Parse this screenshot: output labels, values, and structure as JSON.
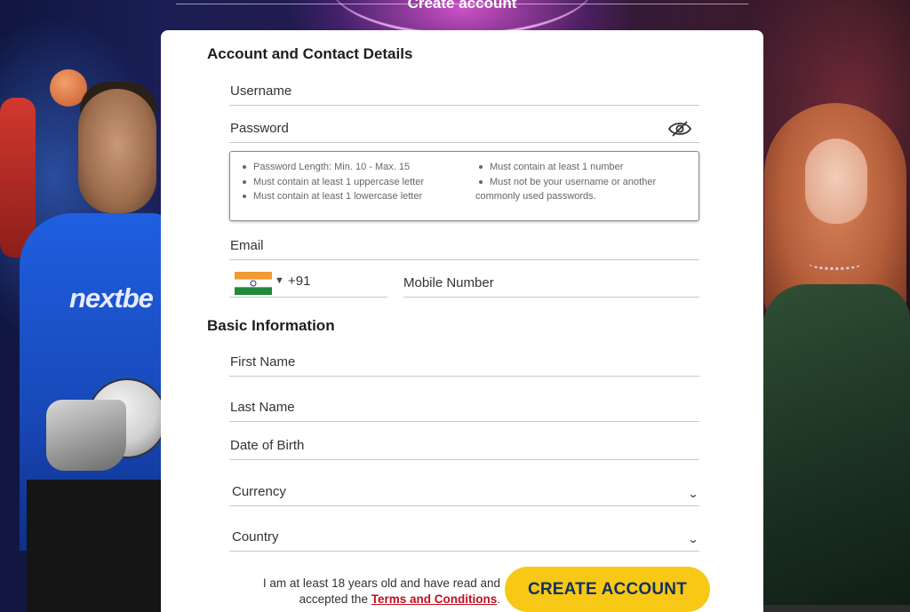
{
  "page": {
    "heading": "Create account"
  },
  "branding": {
    "jersey_logo_a": "nextbe",
    "jersey_logo_b": ""
  },
  "form": {
    "account_section_title": "Account and Contact Details",
    "username_label": "Username",
    "password_label": "Password",
    "password_rules_col_a": [
      "Password Length: Min. 10 - Max. 15",
      "Must contain at least 1 uppercase letter",
      "Must contain at least 1 lowercase letter"
    ],
    "password_rules_col_b": [
      "Must contain at least 1 number",
      "Must not be your username or another",
      "commonly used passwords."
    ],
    "email_label": "Email",
    "phone_country_flag": "india-flag-icon",
    "phone_dial_code": "+91",
    "mobile_label": "Mobile Number",
    "basic_section_title": "Basic Information",
    "first_name_label": "First Name",
    "last_name_label": "Last Name",
    "dob_label": "Date of Birth",
    "currency_label": "Currency",
    "country_label": "Country",
    "consent_text": "I am at least 18 years old and have read and accepted the",
    "terms_link": "Terms and Conditions",
    "consent_end": ".",
    "submit_label": "CREATE ACCOUNT"
  },
  "icons": {
    "password_toggle": "eye-slash-icon",
    "select_chevron": "chevron-down-icon"
  },
  "colors": {
    "accent_button": "#f7c815",
    "button_text": "#14305e",
    "terms_link": "#c0101e"
  }
}
